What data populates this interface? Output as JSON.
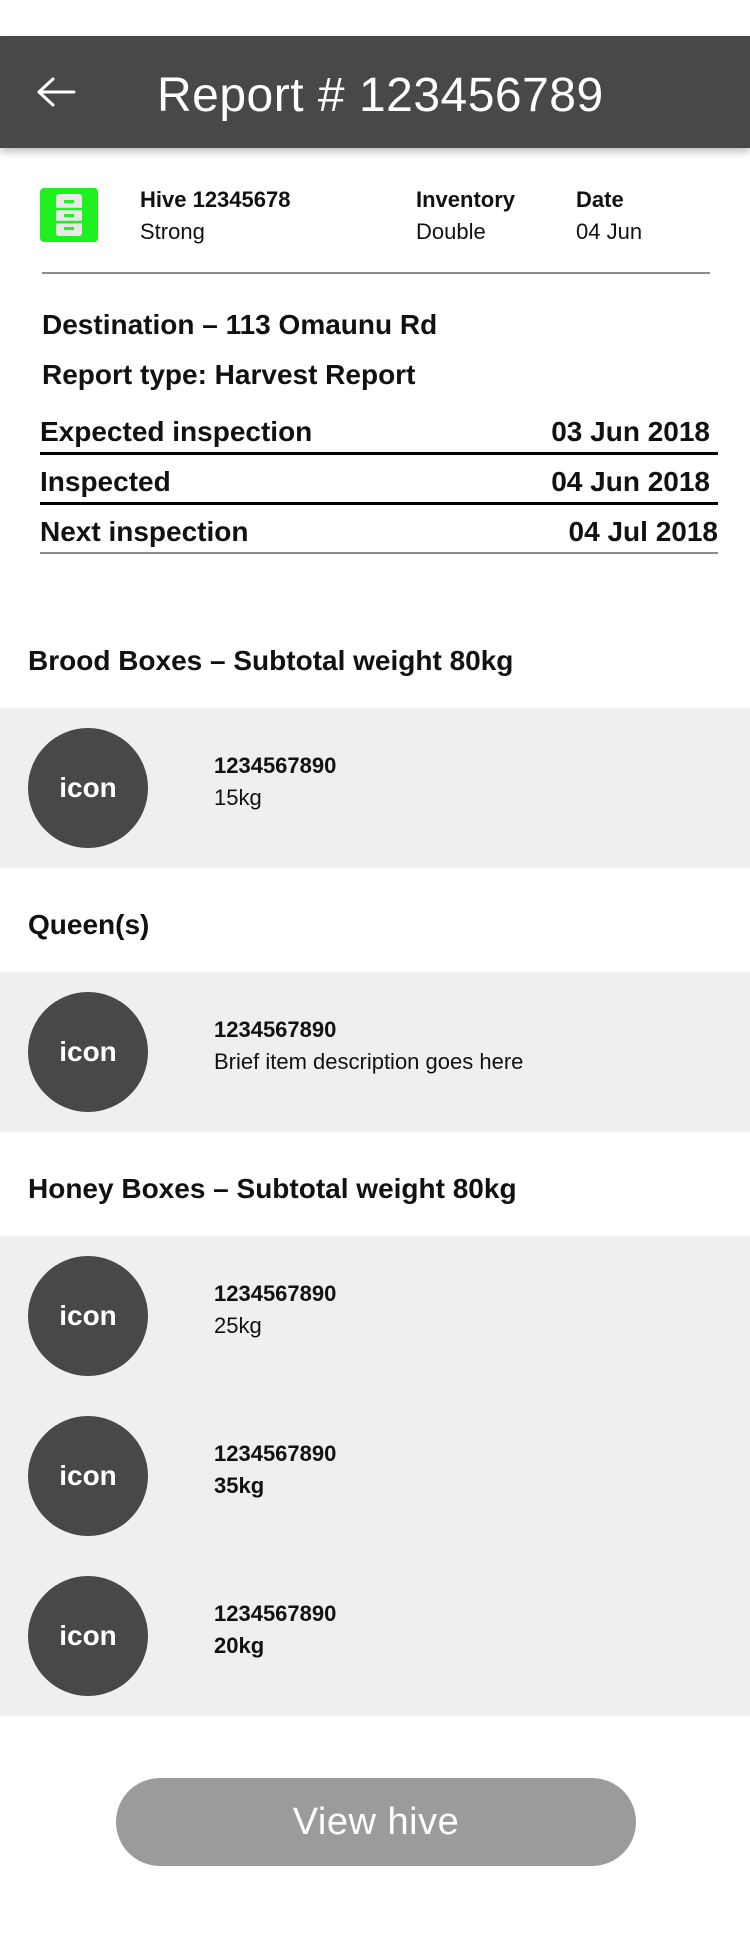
{
  "header": {
    "title": "Report # 123456789",
    "background_color": "#484848"
  },
  "hive_summary": {
    "icon": "hive-box-icon",
    "icon_color": "#1ff01f",
    "hive_label": "Hive 12345678",
    "hive_status": "Strong",
    "inventory_label": "Inventory",
    "inventory_value": "Double",
    "date_label": "Date",
    "date_value": "04 Jun"
  },
  "details": {
    "destination": "Destination – 113 Omaunu Rd",
    "report_type": "Report type: Harvest Report",
    "inspections": [
      {
        "label": "Expected inspection",
        "value": "03 Jun 2018"
      },
      {
        "label": "Inspected",
        "value": "04 Jun 2018"
      },
      {
        "label": "Next inspection",
        "value": "04 Jul 2018"
      }
    ]
  },
  "sections": [
    {
      "heading": "Brood Boxes – Subtotal weight 80kg",
      "items": [
        {
          "icon_text": "icon",
          "id": "1234567890",
          "description": "15kg"
        }
      ]
    },
    {
      "heading": "Queen(s)",
      "items": [
        {
          "icon_text": "icon",
          "id": "1234567890",
          "description": "Brief item description goes here"
        }
      ]
    },
    {
      "heading": "Honey Boxes – Subtotal weight 80kg",
      "items": [
        {
          "icon_text": "icon",
          "id": "1234567890",
          "description": "25kg"
        },
        {
          "icon_text": "icon",
          "id": "1234567890",
          "description": "35kg"
        },
        {
          "icon_text": "icon",
          "id": "1234567890",
          "description": "20kg"
        }
      ]
    }
  ],
  "footer": {
    "view_hive_label": "View hive",
    "button_color": "#9b9b9b"
  }
}
